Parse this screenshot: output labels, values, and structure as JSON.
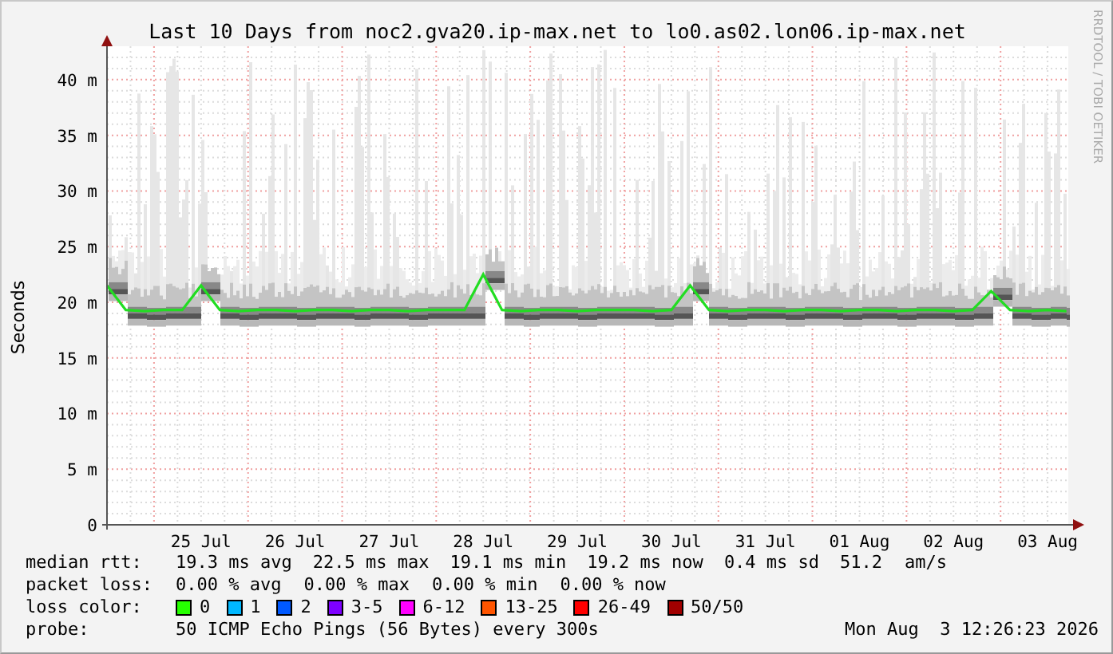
{
  "chart": {
    "side_label": "RRDTOOL / TOBI OETIKER",
    "chart_data": {
      "type": "line",
      "title": "Last 10 Days from noc2.gva20.ip-max.net to lo0.as02.lon06.ip-max.net",
      "ylabel": "Seconds",
      "categories": [
        null,
        null,
        null,
        null,
        null,
        "25 Jul",
        null,
        null,
        null,
        null,
        "26 Jul",
        null,
        null,
        null,
        null,
        "27 Jul",
        null,
        null,
        null,
        null,
        "28 Jul",
        null,
        null,
        null,
        null,
        "29 Jul",
        null,
        null,
        null,
        null,
        "30 Jul",
        null,
        null,
        null,
        null,
        "31 Jul",
        null,
        null,
        null,
        null,
        "01 Aug",
        null,
        null,
        null,
        null,
        "02 Aug",
        null,
        null,
        null,
        null,
        "03 Aug",
        null
      ],
      "ylim": [
        0,
        43
      ],
      "grid": true,
      "yticks": [
        {
          "value": 0,
          "label": "0"
        },
        {
          "value": 5,
          "label": "5 m"
        },
        {
          "value": 10,
          "label": "10 m"
        },
        {
          "value": 15,
          "label": "15 m"
        },
        {
          "value": 20,
          "label": "20 m"
        },
        {
          "value": 25,
          "label": "25 m"
        },
        {
          "value": 30,
          "label": "30 m"
        },
        {
          "value": 35,
          "label": "35 m"
        },
        {
          "value": 40,
          "label": "40 m"
        }
      ],
      "series": [
        {
          "color": "#22dd22",
          "values": [
            21.5,
            19.3,
            19.2,
            19.3,
            19.3,
            21.5,
            19.3,
            19.2,
            19.3,
            19.3,
            19.2,
            19.3,
            19.3,
            19.2,
            19.3,
            19.3,
            19.2,
            19.3,
            19.3,
            19.3,
            22.5,
            19.3,
            19.2,
            19.3,
            19.3,
            19.2,
            19.3,
            19.3,
            19.3,
            19.2,
            19.3,
            21.5,
            19.3,
            19.2,
            19.3,
            19.3,
            19.2,
            19.3,
            19.3,
            19.2,
            19.3,
            19.3,
            19.2,
            19.3,
            19.3,
            19.2,
            19.3,
            21.0,
            19.3,
            19.2,
            19.3,
            19.2
          ]
        }
      ]
    }
  },
  "legend": {
    "median_rtt": {
      "label": "median rtt:",
      "values": [
        "19.3 ms avg",
        "22.5 ms max",
        "19.1 ms min",
        "19.2 ms now",
        "0.4 ms sd",
        "51.2",
        "am/s"
      ]
    },
    "packet_loss": {
      "label": "packet loss:",
      "values": [
        "0.00 % avg",
        "0.00 % max",
        "0.00 % min",
        "0.00 % now"
      ]
    },
    "loss_color": {
      "label": "loss color:",
      "items": [
        {
          "label": "0",
          "color": "#26ff00"
        },
        {
          "label": "1",
          "color": "#00b8ff"
        },
        {
          "label": "2",
          "color": "#0059ff"
        },
        {
          "label": "3-5",
          "color": "#7e00ff"
        },
        {
          "label": "6-12",
          "color": "#ff00ff"
        },
        {
          "label": "13-25",
          "color": "#ff5500"
        },
        {
          "label": "26-49",
          "color": "#ff0000"
        },
        {
          "label": "50/50",
          "color": "#a10000"
        }
      ]
    },
    "probe": {
      "label": "probe:",
      "text": "50 ICMP Echo Pings (56 Bytes) every 300s",
      "timestamp": "Mon Aug  3 12:26:23 2026"
    }
  }
}
